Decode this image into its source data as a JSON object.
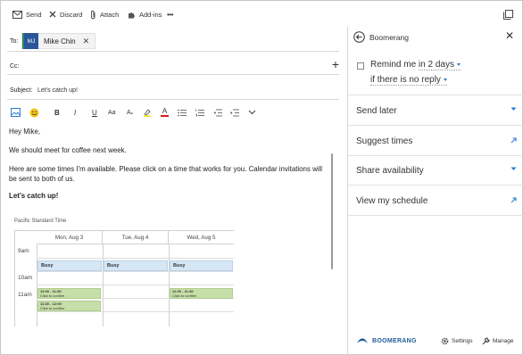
{
  "toolbar": {
    "send": "Send",
    "discard": "Discard",
    "attach": "Attach",
    "addins": "Add-ins",
    "more": "•••"
  },
  "compose": {
    "to_label": "To:",
    "recipient_initials": "MJ",
    "recipient_name": "Mike Chin",
    "cc_label": "Cc:",
    "subject_label": "Subject:",
    "subject_value": "Let's catch up!"
  },
  "body": {
    "greeting": "Hey Mike,",
    "line1": "We should meet for coffee next week.",
    "line2": "Here are some times I'm available. Please click on a time that works for you. Calendar invitations will be sent to both of us.",
    "signoff": "Let's catch up!"
  },
  "calendar": {
    "timezone": "Pacific Standard Time",
    "days": [
      "Mon, Aug 3",
      "Tue, Aug 4",
      "Wed, Aug 5"
    ],
    "times": [
      "9am",
      "10am",
      "11am"
    ],
    "busy_label": "Busy",
    "slot_mon_1_time": "11:00 - 11:30",
    "slot_mon_1_note": "Click to confirm",
    "slot_mon_2_time": "11:30 - 12:00",
    "slot_mon_2_note": "Click to confirm",
    "slot_wed_1_time": "11:00 - 11:30",
    "slot_wed_1_note": "Click to confirm"
  },
  "panel": {
    "title": "Boomerang",
    "remind_prefix": "Remind me",
    "remind_value": "in 2 days",
    "condition_value": "if there is no reply",
    "items": [
      "Send later",
      "Suggest times",
      "Share availability",
      "View my schedule"
    ],
    "logo_text": "BOOMERANG",
    "settings": "Settings",
    "manage": "Manage"
  },
  "colors": {
    "accent": "#2b7bd3",
    "avatar": "#2b579a",
    "busy": "#d5e6f5",
    "slot": "#c6dea8"
  }
}
